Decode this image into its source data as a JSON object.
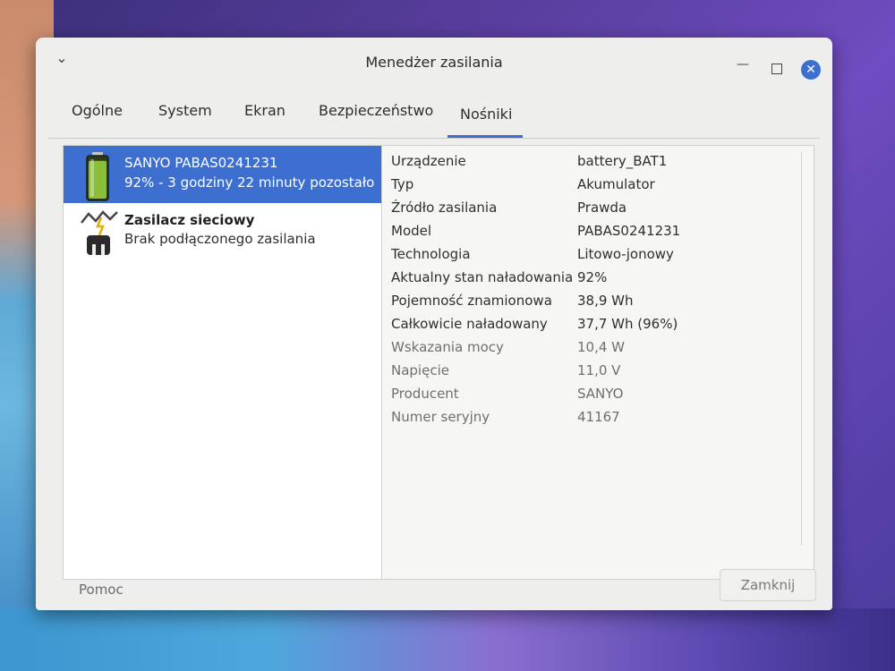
{
  "window": {
    "title": "Menedżer zasilania",
    "menu_icon": "chevron-down-icon",
    "close_icon": "close-icon",
    "minimize_icon": "minimize-icon",
    "maximize_icon": "maximize-icon"
  },
  "tabs": [
    {
      "label": "Ogólne"
    },
    {
      "label": "System"
    },
    {
      "label": "Ekran"
    },
    {
      "label": "Bezpieczeństwo"
    },
    {
      "label": "Nośniki",
      "active": true
    }
  ],
  "devices": [
    {
      "name": "SANYO PABAS0241231",
      "status": "92% - 3 godziny 22 minuty pozostało",
      "icon": "battery-icon",
      "selected": true
    },
    {
      "name": "Zasilacz sieciowy",
      "status": "Brak podłączonego zasilania",
      "icon": "power-plug-icon",
      "selected": false
    }
  ],
  "properties": [
    {
      "key": "Urządzenie",
      "value": "battery_BAT1"
    },
    {
      "key": "Typ",
      "value": "Akumulator"
    },
    {
      "key": "Źródło zasilania",
      "value": "Prawda"
    },
    {
      "key": "Model",
      "value": "PABAS0241231"
    },
    {
      "key": "Technologia",
      "value": "Litowo-jonowy"
    },
    {
      "key": "Aktualny stan naładowania",
      "value": "92%"
    },
    {
      "key": "Pojemność znamionowa",
      "value": "38,9 Wh"
    },
    {
      "key": "Całkowicie naładowany",
      "value": "37,7 Wh (96%)"
    },
    {
      "key": "Wskazania mocy",
      "value": "10,4 W"
    },
    {
      "key": "Napięcie",
      "value": "11,0 V"
    },
    {
      "key": "Producent",
      "value": "SANYO"
    },
    {
      "key": "Numer seryjny",
      "value": "41167"
    }
  ],
  "footer": {
    "help_label": "Pomoc",
    "close_label": "Zamknij"
  },
  "colors": {
    "accent": "#3d6fd1",
    "battery_fill": "#8bbf3a"
  },
  "battery_level": 0.92
}
